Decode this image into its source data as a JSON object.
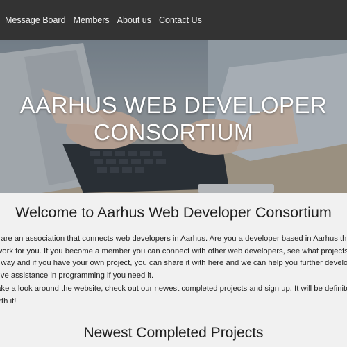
{
  "nav": {
    "items": [
      "Message Board",
      "Members",
      "About us",
      "Contact Us"
    ]
  },
  "hero": {
    "title_line1": "AARHUS WEB DEVELOPER",
    "title_line2": "CONSORTIUM",
    "image": "hands-typing-on-laptop"
  },
  "welcome": {
    "title": "Welcome to Aarhus Web Developer Consortium",
    "paragraph1_lines": [
      "e are an association that connects web developers in Aarhus. Are you a developer based in Aarhus this is the",
      "twork for you. If you become a member you can connect with other web developers, see what projects are on",
      "e way and if you have your own project, you can share it with here and we can help you further develop the id",
      "give assistance in programming if you need it."
    ],
    "paragraph2_lines": [
      "take a look around the website, check out our newest completed projects and sign up. It will be definitely be",
      "orth it!"
    ]
  },
  "projects": {
    "title": "Newest Completed Projects"
  },
  "colors": {
    "navbar": "#333333",
    "nav_text": "#f2f2f2",
    "page_bg": "#f1f1f1"
  }
}
